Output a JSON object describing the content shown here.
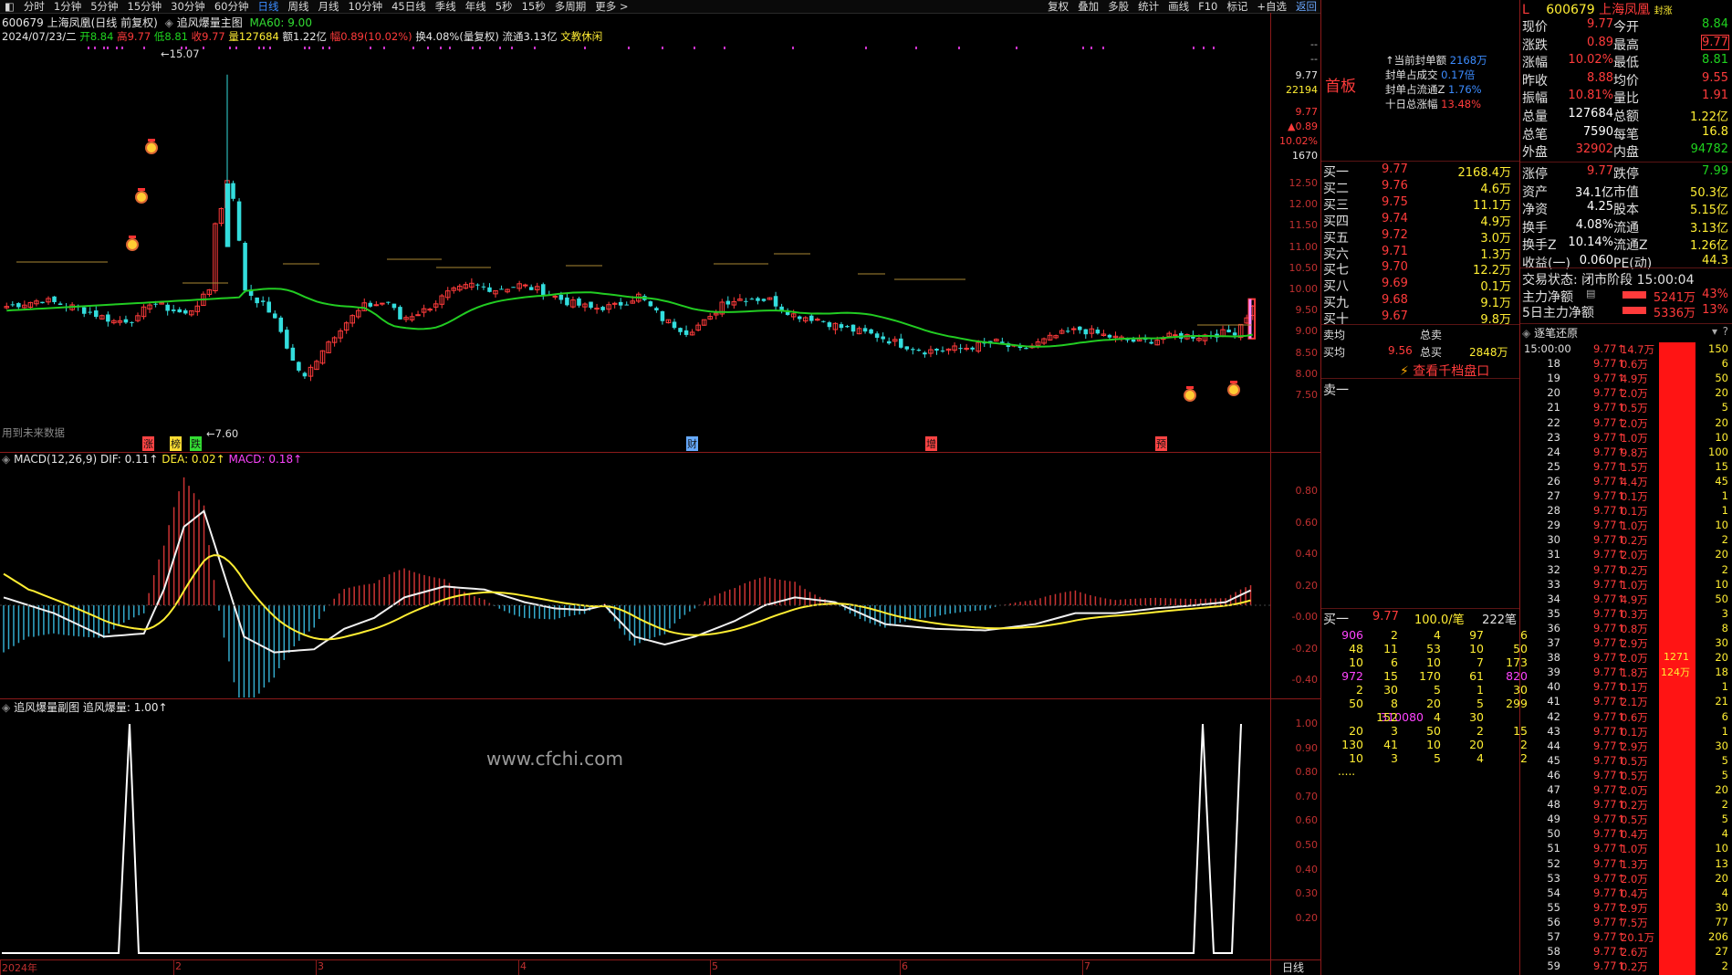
{
  "toolbar": {
    "periods": [
      "分时",
      "1分钟",
      "5分钟",
      "15分钟",
      "30分钟",
      "60分钟",
      "日线",
      "周线",
      "月线",
      "10分钟",
      "45日线",
      "季线",
      "年线",
      "5秒",
      "15秒",
      "多周期",
      "更多 >"
    ],
    "active_period": "日线",
    "right": [
      "复权",
      "叠加",
      "多股",
      "统计",
      "画线",
      "F10",
      "标记",
      "+自选",
      "返回"
    ]
  },
  "main_chart": {
    "header": "600679 上海凤凰(日线 前复权)",
    "indicator_name": "追风爆量主图",
    "ma60": "MA60: 9.00",
    "date": "2024/07/23/二",
    "open": "开8.84",
    "high": "高9.77",
    "low": "低8.81",
    "close": "收9.77",
    "volume": "量127684",
    "amount": "额1.22亿",
    "change": "幅0.89(10.02%)",
    "turnover": "换4.08%(量复权)",
    "float": "流通3.13亿",
    "concept": "文教休闲",
    "future_data": "用到未来数据",
    "max_label": "15.07",
    "min_label": "7.60",
    "y_labels": [
      "12.50",
      "12.00",
      "11.50",
      "11.00",
      "10.50",
      "10.00",
      "9.50",
      "9.00",
      "8.50",
      "8.00",
      "7.50"
    ],
    "right_values": [
      "--",
      "--",
      "9.77",
      "22194",
      "9.77",
      "▲0.89",
      "10.02%",
      "1670"
    ],
    "events": [
      "涨",
      "榜",
      "跌",
      "财",
      "增",
      "预"
    ]
  },
  "macd": {
    "title": "MACD(12,26,9)",
    "dif": "DIF: 0.11↑",
    "dea": "DEA: 0.02↑",
    "macd": "MACD: 0.18↑",
    "y_labels": [
      "0.80",
      "0.60",
      "0.40",
      "0.20",
      "-0.00",
      "-0.20",
      "-0.40"
    ]
  },
  "sub": {
    "title": "追风爆量副图",
    "value": "追风爆量: 1.00↑",
    "y_labels": [
      "1.00",
      "0.90",
      "0.80",
      "0.70",
      "0.60",
      "0.50",
      "0.40",
      "0.30",
      "0.20"
    ],
    "watermark": "www.cfchi.com"
  },
  "xaxis": {
    "labels": [
      "2024年",
      "2",
      "3",
      "4",
      "5",
      "6",
      "7"
    ],
    "period_label": "日线"
  },
  "seal": {
    "title": "首板",
    "rows": [
      {
        "k": "↑当前封单额",
        "v": "2168万"
      },
      {
        "k": "封单占成交",
        "v": "0.17倍"
      },
      {
        "k": "封单占流通Z",
        "v": "1.76%"
      },
      {
        "k": "十日总涨幅",
        "v": "13.48%"
      }
    ]
  },
  "quote": {
    "code": "600679",
    "name": "上海凤凰",
    "tag": "封涨",
    "rows": [
      [
        "现价",
        "9.77",
        "今开",
        "8.84"
      ],
      [
        "涨跌",
        "0.89",
        "最高",
        "9.77"
      ],
      [
        "涨幅",
        "10.02%",
        "最低",
        "8.81"
      ],
      [
        "昨收",
        "8.88",
        "均价",
        "9.55"
      ],
      [
        "振幅",
        "10.81%",
        "量比",
        "1.91"
      ],
      [
        "总量",
        "127684",
        "总额",
        "1.22亿"
      ],
      [
        "总笔",
        "7590",
        "每笔",
        "16.8"
      ],
      [
        "外盘",
        "32902",
        "内盘",
        "94782"
      ]
    ],
    "rows2": [
      [
        "涨停",
        "9.77",
        "跌停",
        "7.99"
      ],
      [
        "资产",
        "34.1亿",
        "市值",
        "50.3亿"
      ],
      [
        "净资",
        "4.25",
        "股本",
        "5.15亿"
      ],
      [
        "换手",
        "4.08%",
        "流通",
        "3.13亿"
      ],
      [
        "换手Z",
        "10.14%",
        "流通Z",
        "1.26亿"
      ],
      [
        "收益(一)",
        "0.060",
        "PE(动)",
        "44.3"
      ]
    ],
    "status": "交易状态: 闭市阶段 15:00:04",
    "flow": [
      {
        "k": "主力净额",
        "v": "5241万",
        "p": "43%"
      },
      {
        "k": "5日主力净额",
        "v": "5336万",
        "p": "13%"
      }
    ]
  },
  "book": {
    "bids": [
      [
        "买一",
        "9.77",
        "2168.4万"
      ],
      [
        "买二",
        "9.76",
        "4.6万"
      ],
      [
        "买三",
        "9.75",
        "11.1万"
      ],
      [
        "买四",
        "9.74",
        "4.9万"
      ],
      [
        "买五",
        "9.72",
        "3.0万"
      ],
      [
        "买六",
        "9.71",
        "1.3万"
      ],
      [
        "买七",
        "9.70",
        "12.2万"
      ],
      [
        "买八",
        "9.69",
        "0.1万"
      ],
      [
        "买九",
        "9.68",
        "9.1万"
      ],
      [
        "买十",
        "9.67",
        "9.8万"
      ]
    ],
    "avg_sell": "卖均",
    "total_sell": "总卖",
    "avg_buy": "买均",
    "avg_buy_val": "9.56",
    "total_buy": "总买",
    "total_buy_val": "2848万",
    "thousand_link": "查看千档盘口",
    "sell_one": "卖一",
    "queue_head": [
      "买一",
      "9.77",
      "100.0/笔",
      "222笔"
    ],
    "queue": [
      [
        "906",
        "2",
        "4",
        "97",
        "6"
      ],
      [
        "48",
        "11",
        "53",
        "10",
        "50"
      ],
      [
        "10",
        "6",
        "10",
        "7",
        "173"
      ],
      [
        "972",
        "15",
        "170",
        "61",
        "820"
      ],
      [
        "2",
        "30",
        "5",
        "1",
        "30"
      ],
      [
        "50",
        "8",
        "20",
        "5",
        "299"
      ],
      [
        "310080",
        "152",
        "4",
        "30"
      ],
      [
        "20",
        "3",
        "50",
        "2",
        "15"
      ],
      [
        "130",
        "41",
        "10",
        "20",
        "2"
      ],
      [
        "10",
        "3",
        "5",
        "4",
        "2"
      ]
    ],
    "more": "....."
  },
  "ticks": {
    "title": "逐笔还原",
    "first_time": "15:00:00",
    "price": "9.77",
    "rows": [
      [
        "",
        "14.7万",
        "150"
      ],
      [
        "18",
        "0.6万",
        "6"
      ],
      [
        "19",
        "4.9万",
        "50"
      ],
      [
        "20",
        "2.0万",
        "20"
      ],
      [
        "21",
        "0.5万",
        "5"
      ],
      [
        "22",
        "2.0万",
        "20"
      ],
      [
        "23",
        "1.0万",
        "10"
      ],
      [
        "24",
        "9.8万",
        "100"
      ],
      [
        "25",
        "1.5万",
        "15"
      ],
      [
        "26",
        "4.4万",
        "45"
      ],
      [
        "27",
        "0.1万",
        "1"
      ],
      [
        "28",
        "0.1万",
        "1"
      ],
      [
        "29",
        "1.0万",
        "10"
      ],
      [
        "30",
        "0.2万",
        "2"
      ],
      [
        "31",
        "2.0万",
        "20"
      ],
      [
        "32",
        "0.2万",
        "2"
      ],
      [
        "33",
        "1.0万",
        "10"
      ],
      [
        "34",
        "4.9万",
        "50"
      ],
      [
        "35",
        "0.3万",
        "3"
      ],
      [
        "36",
        "0.8万",
        "8"
      ],
      [
        "37",
        "2.9万",
        "30"
      ],
      [
        "38",
        "2.0万",
        "20"
      ],
      [
        "39",
        "1.8万",
        "18"
      ],
      [
        "40",
        "0.1万",
        "1"
      ],
      [
        "41",
        "2.1万",
        "21"
      ],
      [
        "42",
        "0.6万",
        "6"
      ],
      [
        "43",
        "0.1万",
        "1"
      ],
      [
        "44",
        "2.9万",
        "30"
      ],
      [
        "45",
        "0.5万",
        "5"
      ],
      [
        "46",
        "0.5万",
        "5"
      ],
      [
        "47",
        "2.0万",
        "20"
      ],
      [
        "48",
        "0.2万",
        "2"
      ],
      [
        "49",
        "0.5万",
        "5"
      ],
      [
        "50",
        "0.4万",
        "4"
      ],
      [
        "51",
        "1.0万",
        "10"
      ],
      [
        "52",
        "1.3万",
        "13"
      ],
      [
        "53",
        "2.0万",
        "20"
      ],
      [
        "54",
        "0.4万",
        "4"
      ],
      [
        "55",
        "2.9万",
        "30"
      ],
      [
        "56",
        "7.5万",
        "77"
      ],
      [
        "57",
        "20.1万",
        "206"
      ],
      [
        "58",
        "2.6万",
        "27"
      ],
      [
        "59",
        "0.2万",
        "2"
      ]
    ],
    "bar_label1": "1271",
    "bar_label2": "124万"
  }
}
